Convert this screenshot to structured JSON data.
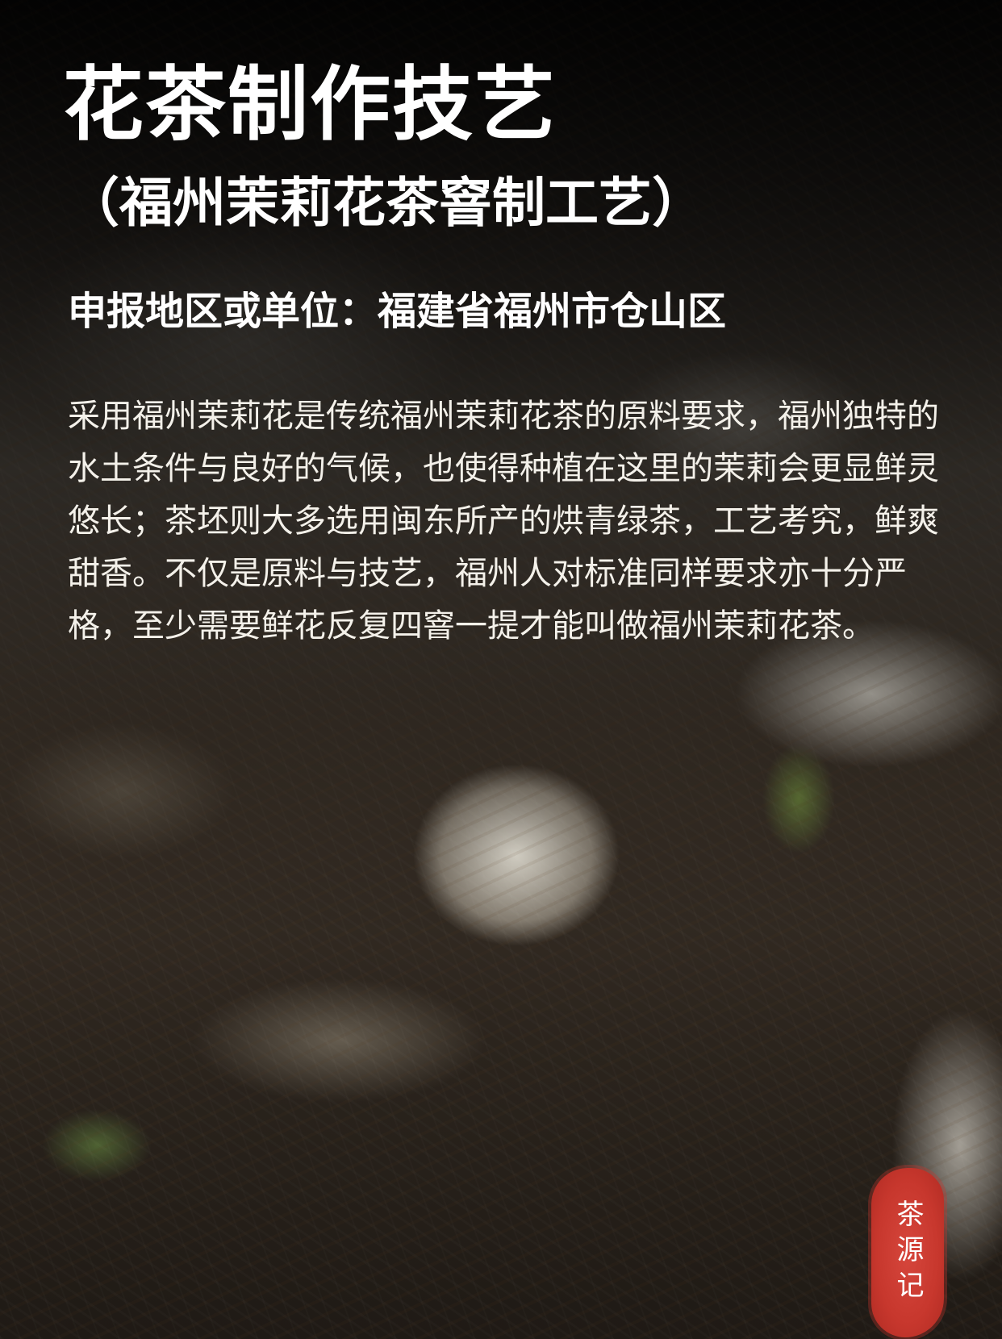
{
  "title": "花茶制作技艺",
  "subtitle": "（福州茉莉花茶窨制工艺）",
  "applicant": "申报地区或单位：福建省福州市仓山区",
  "body": "采用福州茉莉花是传统福州茉莉花茶的原料要求，福州独特的水土条件与良好的气候，也使得种植在这里的茉莉会更显鲜灵悠长；茶坯则大多选用闽东所产的烘青绿茶，工艺考究，鲜爽甜香。不仅是原料与技艺，福州人对标准同样要求亦十分严格，至少需要鲜花反复四窨一提才能叫做福州茉莉花茶。",
  "seal": "茶源记",
  "colors": {
    "text": "#ffffff",
    "seal": "#c7372d"
  }
}
